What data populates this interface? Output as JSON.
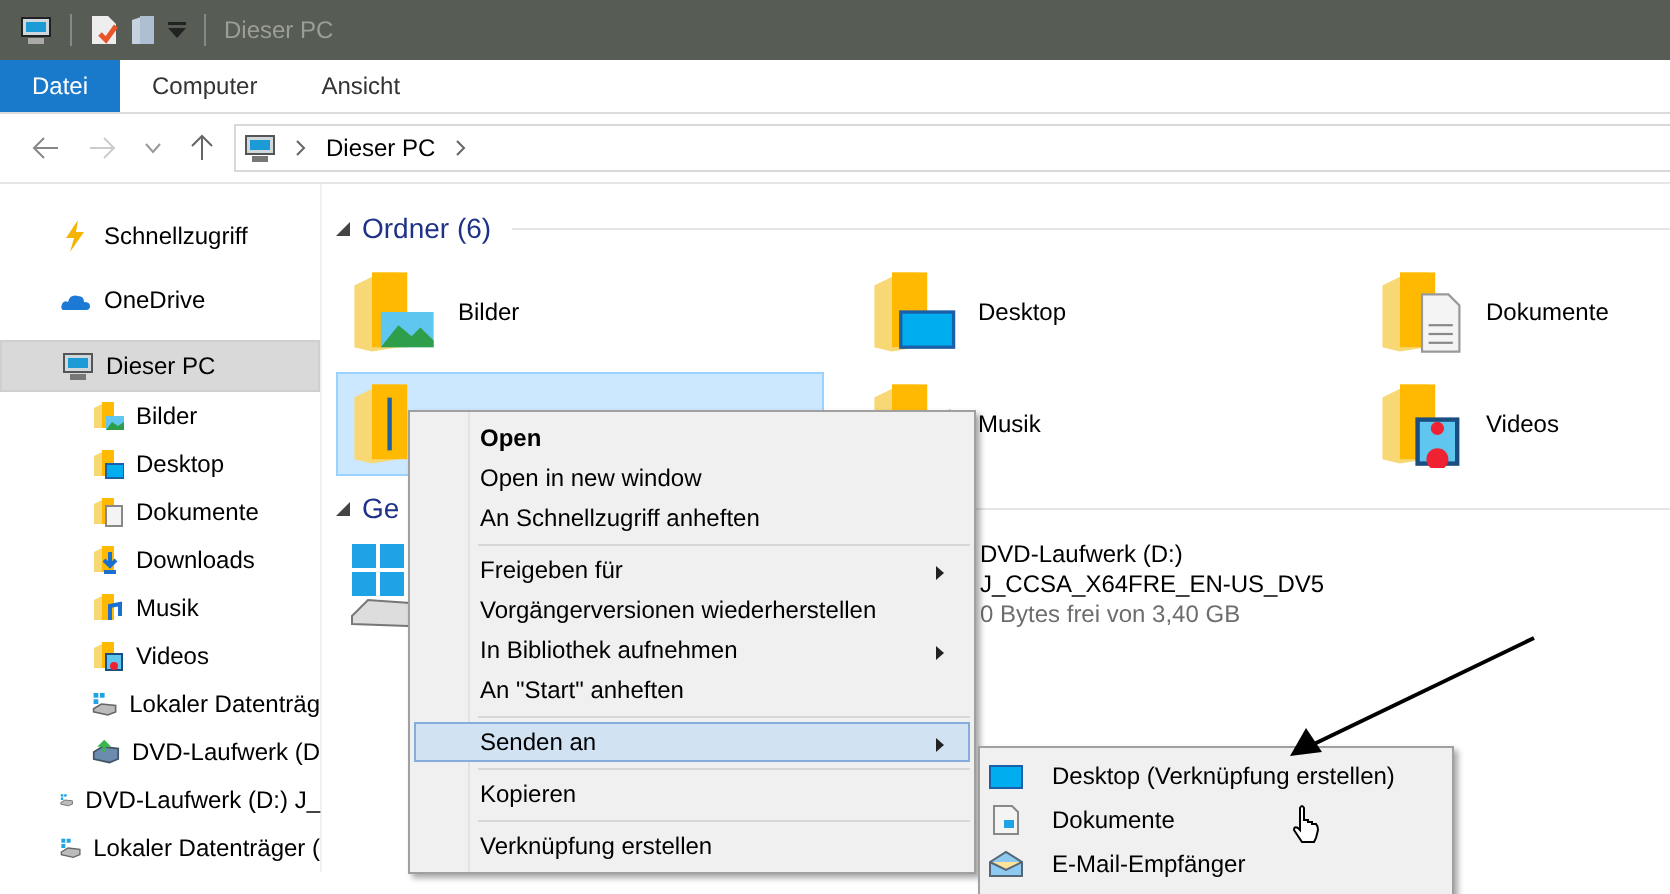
{
  "window": {
    "title": "Dieser PC"
  },
  "ribbon_tabs": [
    {
      "label": "Datei",
      "selected": true
    },
    {
      "label": "Computer",
      "selected": false
    },
    {
      "label": "Ansicht",
      "selected": false
    }
  ],
  "address_bar": {
    "path": [
      "Dieser PC"
    ]
  },
  "sidebar": {
    "items": [
      {
        "label": "Schnellzugriff",
        "selected": false
      },
      {
        "label": "OneDrive",
        "selected": false
      },
      {
        "label": "Dieser PC",
        "selected": true,
        "children": [
          {
            "label": "Bilder",
            "selected": false
          },
          {
            "label": "Desktop",
            "selected": false
          },
          {
            "label": "Dokumente",
            "selected": false
          },
          {
            "label": "Downloads",
            "selected": false
          },
          {
            "label": "Musik",
            "selected": false
          },
          {
            "label": "Videos",
            "selected": false
          },
          {
            "label": "Lokaler Datenträg",
            "selected": false
          },
          {
            "label": "DVD-Laufwerk (D",
            "selected": false
          }
        ]
      },
      {
        "label": "DVD-Laufwerk (D:) J_",
        "selected": false
      },
      {
        "label": "Lokaler Datenträger (",
        "selected": false
      }
    ]
  },
  "folders_section": {
    "title": "Ordner (6)",
    "expanded": true,
    "items": [
      {
        "label": "Bilder",
        "selected": false
      },
      {
        "label": "Desktop",
        "selected": false
      },
      {
        "label": "Dokumente",
        "selected": false
      },
      {
        "selected": true
      },
      {
        "label": "Musik",
        "selected": false
      },
      {
        "label": "Videos",
        "selected": false
      }
    ]
  },
  "devices_section": {
    "title": "Ge",
    "expanded": true,
    "items": [
      {
        "kind": "system"
      },
      {
        "kind": "dvd",
        "name": "DVD-Laufwerk (D:)",
        "volume": "J_CCSA_X64FRE_EN-US_DV5",
        "free_space": "0 Bytes frei von 3,40 GB"
      }
    ]
  },
  "context_menu": {
    "groups": [
      [
        {
          "label": "Open",
          "default": true,
          "has_submenu": false,
          "selected": false
        },
        {
          "label": "Open in new window",
          "default": false,
          "has_submenu": false,
          "selected": false
        },
        {
          "label": "An Schnellzugriff anheften",
          "default": false,
          "has_submenu": false,
          "selected": false
        }
      ],
      [
        {
          "label": "Freigeben für",
          "default": false,
          "has_submenu": true,
          "selected": false
        },
        {
          "label": "Vorgängerversionen wiederherstellen",
          "default": false,
          "has_submenu": false,
          "selected": false
        },
        {
          "label": "In Bibliothek aufnehmen",
          "default": false,
          "has_submenu": true,
          "selected": false
        },
        {
          "label": "An \"Start\" anheften",
          "default": false,
          "has_submenu": false,
          "selected": false
        }
      ],
      [
        {
          "label": "Senden an",
          "default": false,
          "has_submenu": true,
          "selected": true
        }
      ],
      [
        {
          "label": "Kopieren",
          "default": false,
          "has_submenu": false,
          "selected": false
        }
      ],
      [
        {
          "label": "Verknüpfung erstellen",
          "default": false,
          "has_submenu": false,
          "selected": false
        }
      ]
    ]
  },
  "submenu": {
    "items": [
      {
        "label": "Desktop (Verknüpfung erstellen)"
      },
      {
        "label": "Dokumente"
      },
      {
        "label": "E-Mail-Empfänger"
      }
    ]
  }
}
